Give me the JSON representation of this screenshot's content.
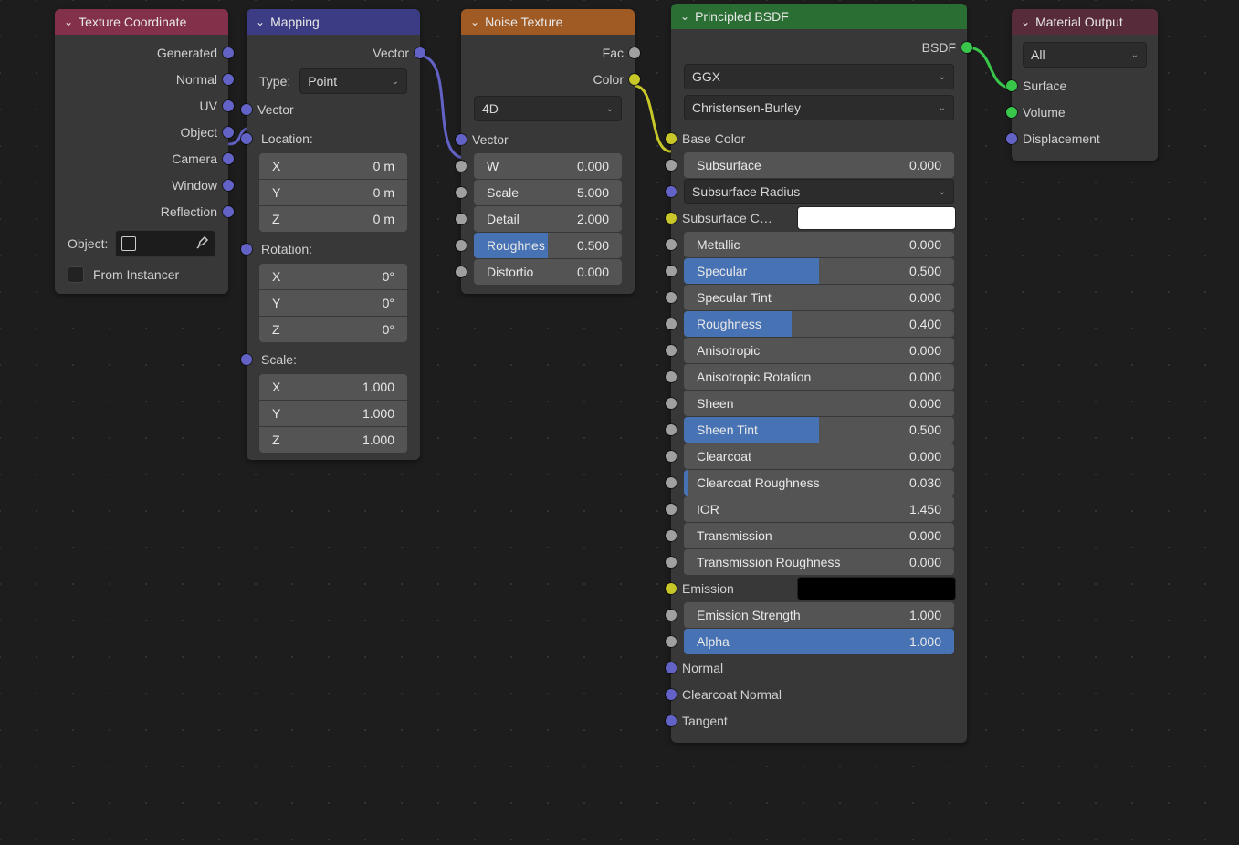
{
  "texcoord": {
    "title": "Texture Coordinate",
    "outputs": [
      "Generated",
      "Normal",
      "UV",
      "Object",
      "Camera",
      "Window",
      "Reflection"
    ],
    "object_label": "Object:",
    "from_instancer": "From Instancer"
  },
  "mapping": {
    "title": "Mapping",
    "out_vector": "Vector",
    "type_label": "Type:",
    "type_value": "Point",
    "in_vector": "Vector",
    "loc_label": "Location:",
    "loc": {
      "x_label": "X",
      "x": "0 m",
      "y_label": "Y",
      "y": "0 m",
      "z_label": "Z",
      "z": "0 m"
    },
    "rot_label": "Rotation:",
    "rot": {
      "x_label": "X",
      "x": "0°",
      "y_label": "Y",
      "y": "0°",
      "z_label": "Z",
      "z": "0°"
    },
    "scale_label": "Scale:",
    "scale": {
      "x_label": "X",
      "x": "1.000",
      "y_label": "Y",
      "y": "1.000",
      "z_label": "Z",
      "z": "1.000"
    }
  },
  "noise": {
    "title": "Noise Texture",
    "out_fac": "Fac",
    "out_color": "Color",
    "dim": "4D",
    "in_vector": "Vector",
    "w": {
      "label": "W",
      "val": "0.000"
    },
    "scale": {
      "label": "Scale",
      "val": "5.000"
    },
    "detail": {
      "label": "Detail",
      "val": "2.000"
    },
    "rough": {
      "label": "Roughnes",
      "val": "0.500",
      "pct": 50
    },
    "distort": {
      "label": "Distortio",
      "val": "0.000"
    }
  },
  "bsdf": {
    "title": "Principled BSDF",
    "out": "BSDF",
    "dist": "GGX",
    "sss_method": "Christensen-Burley",
    "base_color": "Base Color",
    "subsurface": {
      "label": "Subsurface",
      "val": "0.000",
      "pct": 0
    },
    "sss_radius": "Subsurface Radius",
    "sss_color": "Subsurface C…",
    "metallic": {
      "label": "Metallic",
      "val": "0.000",
      "pct": 0
    },
    "specular": {
      "label": "Specular",
      "val": "0.500",
      "pct": 50
    },
    "spec_tint": {
      "label": "Specular Tint",
      "val": "0.000",
      "pct": 0
    },
    "rough": {
      "label": "Roughness",
      "val": "0.400",
      "pct": 40
    },
    "aniso": {
      "label": "Anisotropic",
      "val": "0.000",
      "pct": 0
    },
    "aniso_rot": {
      "label": "Anisotropic Rotation",
      "val": "0.000",
      "pct": 0
    },
    "sheen": {
      "label": "Sheen",
      "val": "0.000",
      "pct": 0
    },
    "sheen_tint": {
      "label": "Sheen Tint",
      "val": "0.500",
      "pct": 50
    },
    "clearcoat": {
      "label": "Clearcoat",
      "val": "0.000",
      "pct": 0
    },
    "cc_rough": {
      "label": "Clearcoat Roughness",
      "val": "0.030",
      "pct": 3,
      "edge": true
    },
    "ior": {
      "label": "IOR",
      "val": "1.450"
    },
    "trans": {
      "label": "Transmission",
      "val": "0.000",
      "pct": 0
    },
    "trans_rough": {
      "label": "Transmission Roughness",
      "val": "0.000",
      "pct": 0
    },
    "emission": "Emission",
    "emit_str": {
      "label": "Emission Strength",
      "val": "1.000"
    },
    "alpha": {
      "label": "Alpha",
      "val": "1.000",
      "pct": 100
    },
    "normal": "Normal",
    "cc_normal": "Clearcoat Normal",
    "tangent": "Tangent"
  },
  "output": {
    "title": "Material Output",
    "target": "All",
    "surface": "Surface",
    "volume": "Volume",
    "displacement": "Displacement"
  }
}
